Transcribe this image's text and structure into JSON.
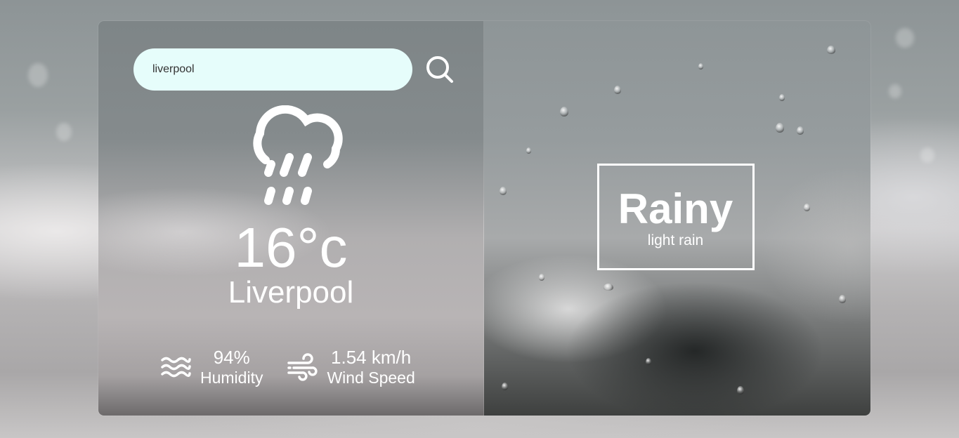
{
  "search": {
    "value": "liverpool",
    "placeholder": ""
  },
  "weather": {
    "icon": "rain-cloud-icon",
    "temperature": "16°c",
    "city": "Liverpool"
  },
  "details": {
    "humidity_value": "94%",
    "humidity_label": "Humidity",
    "humidity_icon": "waves-icon",
    "wind_value": "1.54 km/h",
    "wind_label": "Wind Speed",
    "wind_icon": "wind-icon"
  },
  "condition": {
    "main": "Rainy",
    "description": "light rain"
  },
  "colors": {
    "search_background": "#e6fdfb",
    "text": "#ffffff"
  }
}
